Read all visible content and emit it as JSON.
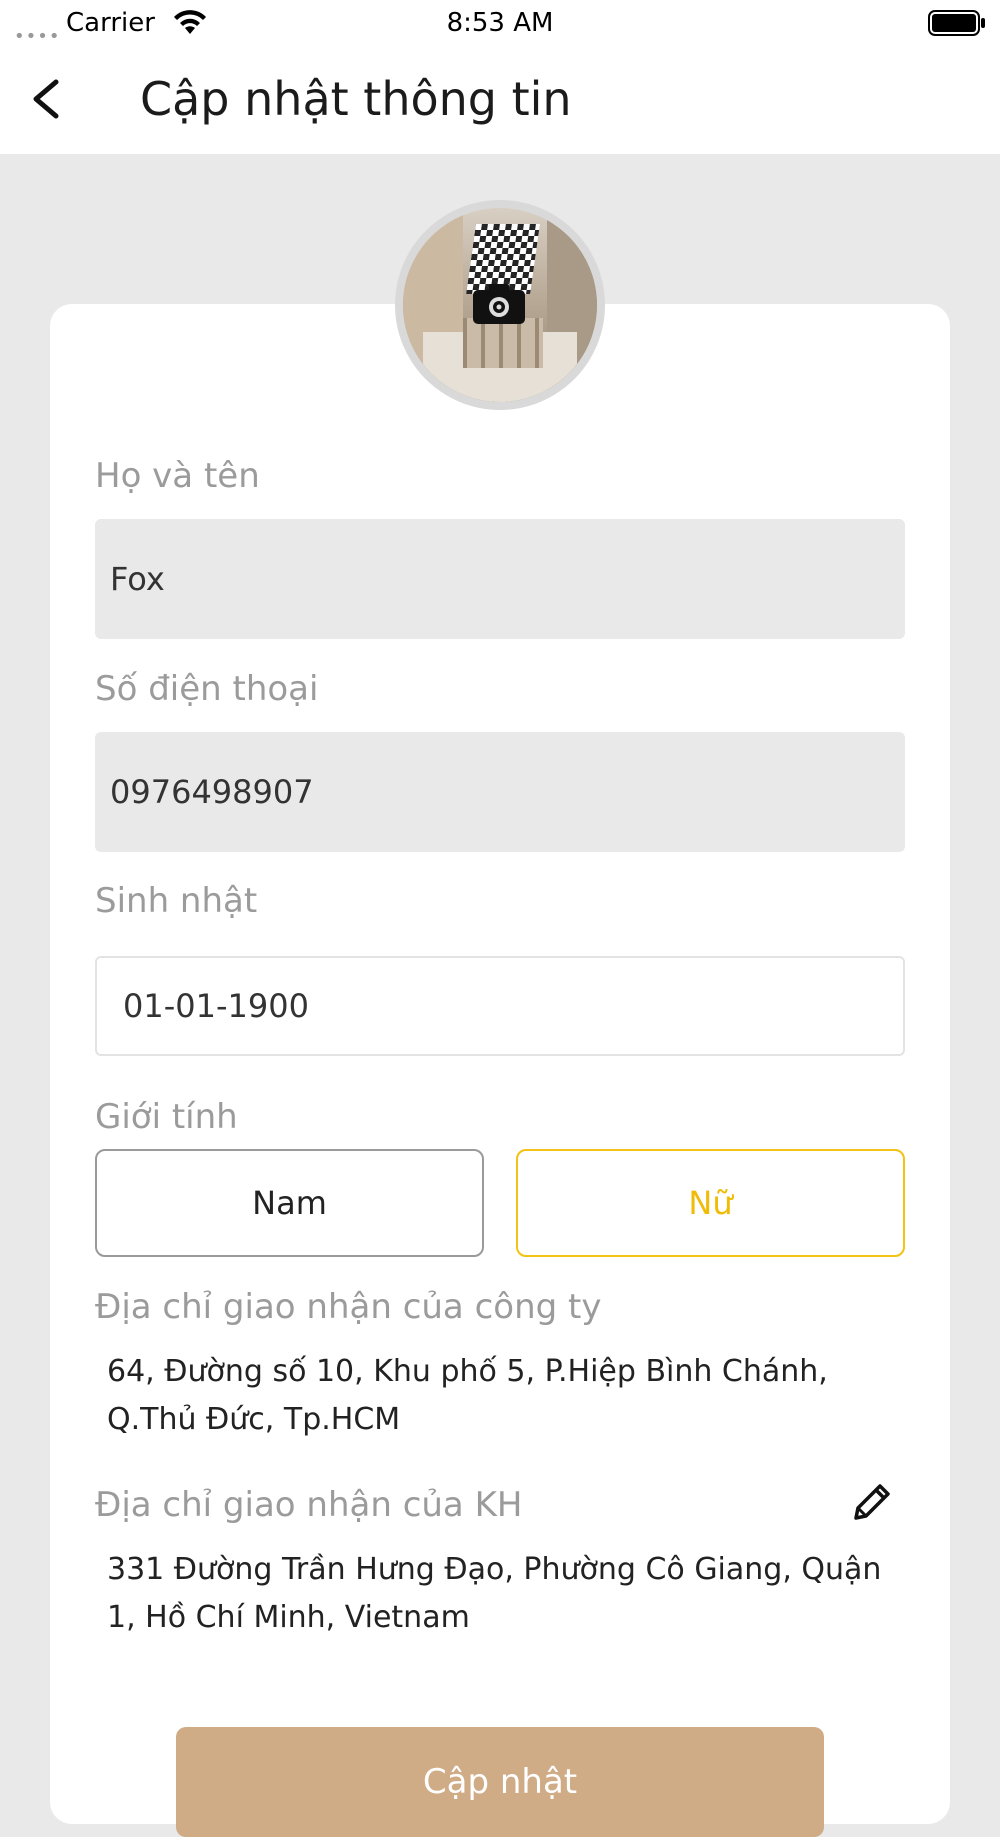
{
  "status_bar": {
    "carrier": "Carrier",
    "time": "8:53 AM",
    "dots": "••••"
  },
  "header": {
    "title": "Cập nhật thông tin",
    "back_icon": "chevron-left-icon"
  },
  "avatar": {
    "icon": "camera-icon"
  },
  "form": {
    "name_label": "Họ và tên",
    "name_value": "Fox",
    "phone_label": "Số điện thoại",
    "phone_value": "0976498907",
    "birthday_label": "Sinh nhật",
    "birthday_value": "01-01-1900",
    "gender_label": "Giới tính",
    "gender_options": [
      "Nam",
      "Nữ"
    ],
    "gender_selected": "Nữ",
    "company_address_label": "Địa chỉ giao nhận của công ty",
    "company_address_line1": "64, Đường số 10, Khu phố 5, P.Hiệp Bình Chánh,",
    "company_address_line2": "Q.Thủ Đức, Tp.HCM",
    "customer_address_label": "Địa chỉ giao nhận của KH",
    "customer_address_line1": "331 Đường Trần Hưng Đạo, Phường Cô Giang, Quận",
    "customer_address_line2": "1, Hồ Chí Minh, Vietnam",
    "edit_icon": "pencil-icon",
    "submit_label": "Cập nhật"
  },
  "colors": {
    "accent_selected": "#f2c314",
    "button_bg": "#cfab86",
    "page_bg": "#e9e9e9"
  }
}
